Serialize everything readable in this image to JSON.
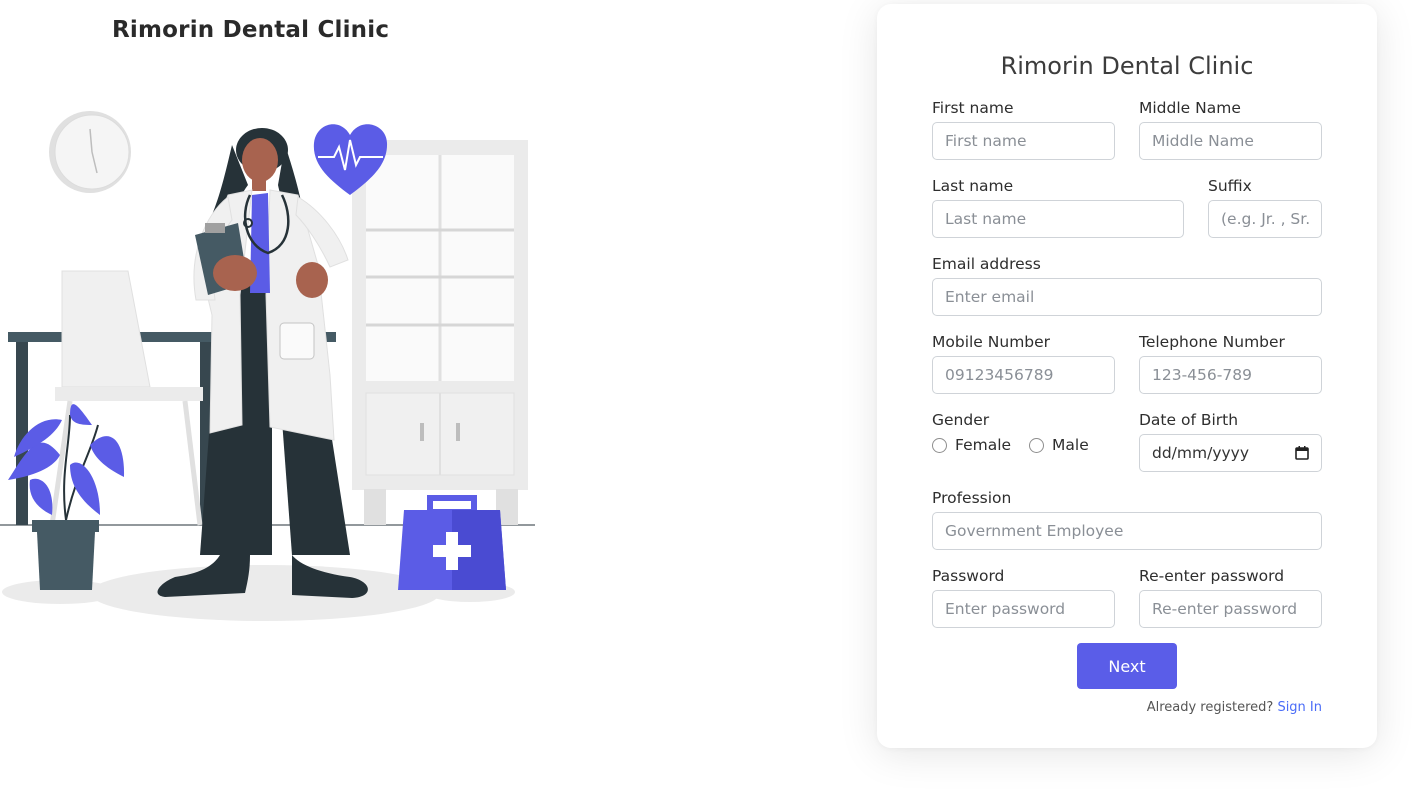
{
  "brand": {
    "title": "Rimorin Dental Clinic"
  },
  "form": {
    "title": "Rimorin Dental Clinic",
    "first_name": {
      "label": "First name",
      "placeholder": "First name"
    },
    "middle_name": {
      "label": "Middle Name",
      "placeholder": "Middle Name"
    },
    "last_name": {
      "label": "Last name",
      "placeholder": "Last name"
    },
    "suffix": {
      "label": "Suffix",
      "placeholder": "(e.g. Jr. , Sr., III)"
    },
    "email": {
      "label": "Email address",
      "placeholder": "Enter email"
    },
    "mobile": {
      "label": "Mobile Number",
      "placeholder": "09123456789"
    },
    "telephone": {
      "label": "Telephone Number",
      "placeholder": "123-456-789"
    },
    "gender": {
      "label": "Gender",
      "options": [
        "Female",
        "Male"
      ]
    },
    "dob": {
      "label": "Date of Birth",
      "value": "dd/mm/yyyy"
    },
    "profession": {
      "label": "Profession",
      "placeholder": "Government Employee"
    },
    "password": {
      "label": "Password",
      "placeholder": "Enter password"
    },
    "repassword": {
      "label": "Re-enter password",
      "placeholder": "Re-enter password"
    },
    "next_label": "Next",
    "already_text": "Already registered?",
    "signin_label": "Sign In"
  },
  "colors": {
    "accent": "#5a5de8",
    "link": "#4a6cf7",
    "illustration_purple": "#5b5ce6",
    "illustration_dark": "#263238"
  }
}
